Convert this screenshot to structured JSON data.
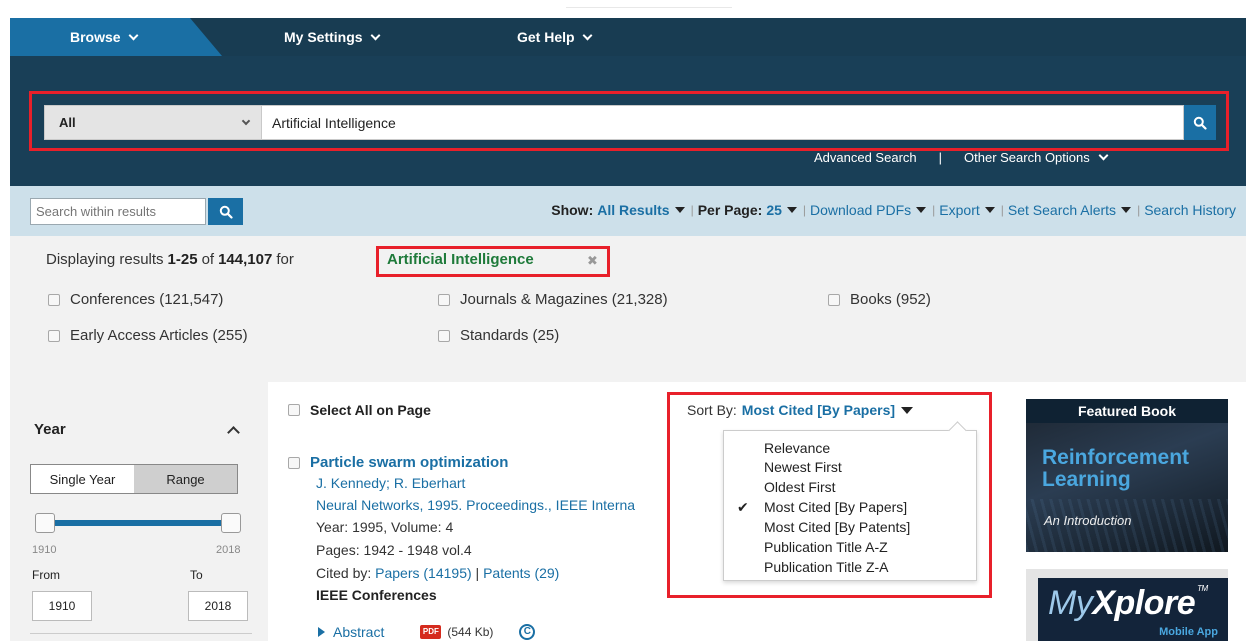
{
  "nav": {
    "browse": "Browse",
    "settings": "My Settings",
    "help": "Get Help"
  },
  "search": {
    "scope": "All",
    "query": "Artificial Intelligence",
    "advanced": "Advanced Search",
    "separator": "|",
    "other_options": "Other Search Options"
  },
  "toolbar": {
    "within_placeholder": "Search within results",
    "show_label": "Show:",
    "show_value": "All Results",
    "per_page_label": "Per Page:",
    "per_page_value": "25",
    "download": "Download PDFs",
    "export": "Export",
    "alerts": "Set Search Alerts",
    "history": "Search History",
    "divider": "|"
  },
  "summary": {
    "prefix": "Displaying results",
    "range": "1-25",
    "of": "of",
    "total": "144,107",
    "for": "for",
    "query": "Artificial Intelligence",
    "remove": "✖"
  },
  "facets": [
    {
      "label": "Conferences (121,547)"
    },
    {
      "label": "Journals & Magazines (21,328)"
    },
    {
      "label": "Books (952)"
    },
    {
      "label": "Early Access Articles (255)"
    },
    {
      "label": "Standards (25)"
    }
  ],
  "sidebar": {
    "title": "Year",
    "single": "Single Year",
    "range": "Range",
    "min": "1910",
    "max": "2018",
    "from_label": "From",
    "to_label": "To",
    "from_value": "1910",
    "to_value": "2018"
  },
  "results": {
    "select_all": "Select All on Page",
    "item": {
      "title": "Particle swarm optimization",
      "authors": "J. Kennedy; R. Eberhart",
      "publication": "Neural Networks, 1995. Proceedings., IEEE Interna",
      "year_volume": "Year: 1995, Volume: 4",
      "pages": "Pages: 1942 - 1948 vol.4",
      "cited_label": "Cited by:",
      "cited_papers": "Papers (14195)",
      "cited_sep": "|",
      "cited_patents": "Patents (29)",
      "source": "IEEE Conferences",
      "abstract": "Abstract",
      "pdf_badge": "PDF",
      "pdf_size": "(544 Kb)",
      "copyright": "C"
    }
  },
  "sort": {
    "label": "Sort By:",
    "value": "Most Cited [By Papers]",
    "check": "✔",
    "options": [
      "Relevance",
      "Newest First",
      "Oldest First",
      "Most Cited [By Papers]",
      "Most Cited [By Patents]",
      "Publication Title A-Z",
      "Publication Title Z-A"
    ]
  },
  "featured": {
    "header": "Featured Book",
    "title_line1": "Reinforcement",
    "title_line2": "Learning",
    "subtitle": "An Introduction"
  },
  "app_promo": {
    "logo_light": "My",
    "logo_bold": "Xplore",
    "tm": "TM",
    "sub": "Mobile App"
  }
}
